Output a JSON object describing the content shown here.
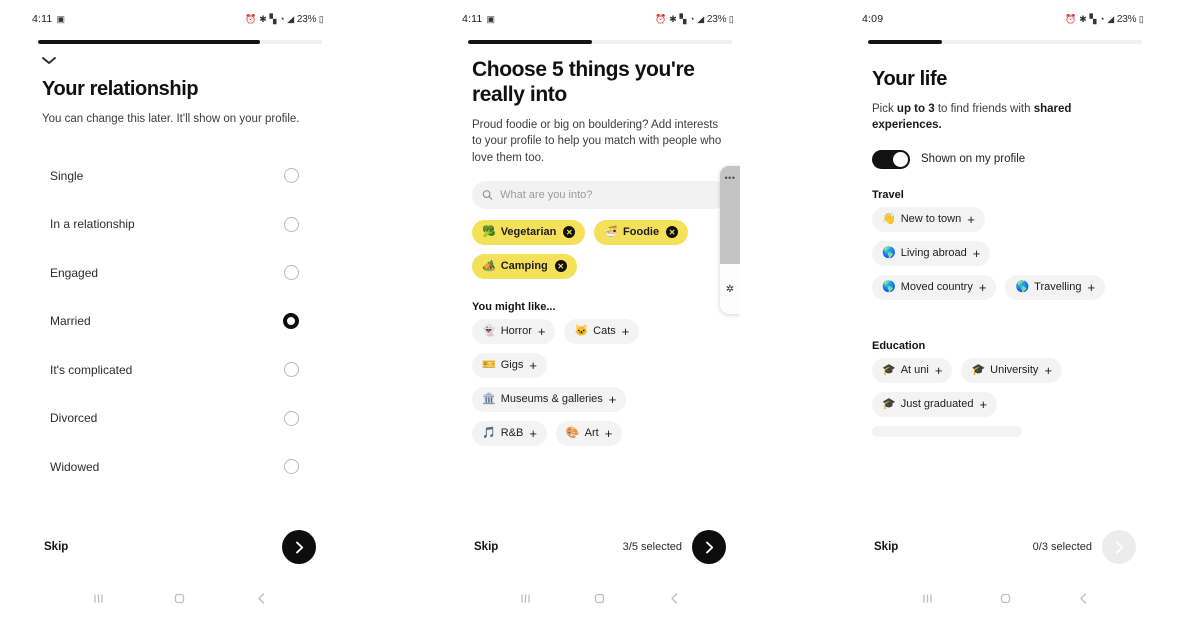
{
  "screens": [
    {
      "id": "relationship",
      "status": {
        "time": "4:11",
        "icons": [
          "alarm-icon",
          "bluetooth-icon",
          "wifi-icon",
          "mute-icon",
          "signal-icon"
        ],
        "battery": "23%"
      },
      "progress_percent": 78,
      "collapse_icon": "chevron-down-icon",
      "title": "Your relationship",
      "subtitle": "You can change this later. It'll show on your profile.",
      "options": [
        {
          "label": "Single",
          "selected": false
        },
        {
          "label": "In a relationship",
          "selected": false
        },
        {
          "label": "Engaged",
          "selected": false
        },
        {
          "label": "Married",
          "selected": true
        },
        {
          "label": "It's complicated",
          "selected": false
        },
        {
          "label": "Divorced",
          "selected": false
        },
        {
          "label": "Widowed",
          "selected": false
        }
      ],
      "skip_label": "Skip",
      "counter": "",
      "next_enabled": true,
      "nav": [
        "recents-icon",
        "home-icon",
        "back-icon"
      ]
    },
    {
      "id": "interests",
      "status": {
        "time": "4:11",
        "icons": [
          "alarm-icon",
          "bluetooth-icon",
          "wifi-icon",
          "mute-icon",
          "signal-icon"
        ],
        "battery": "23%"
      },
      "progress_percent": 47,
      "title": "Choose 5 things you're really into",
      "subtitle": "Proud foodie or big on bouldering? Add interests to your profile to help you match with people who love them too.",
      "search": {
        "placeholder": "What are you into?",
        "value": "",
        "icon": "search-icon"
      },
      "selected_chips": [
        {
          "emoji": "🥦",
          "label": "Vegetarian",
          "action": "remove"
        },
        {
          "emoji": "🍜",
          "label": "Foodie",
          "action": "remove"
        },
        {
          "emoji": "🏕️",
          "label": "Camping",
          "action": "remove"
        }
      ],
      "suggest_heading": "You might like...",
      "suggest_rows": [
        [
          {
            "emoji": "👻",
            "label": "Horror"
          },
          {
            "emoji": "🐱",
            "label": "Cats"
          }
        ],
        [
          {
            "emoji": "🎫",
            "label": "Gigs"
          }
        ],
        [
          {
            "emoji": "🏛️",
            "label": "Museums & galleries"
          }
        ],
        [
          {
            "emoji": "🎵",
            "label": "R&B"
          },
          {
            "emoji": "🎨",
            "label": "Art"
          }
        ]
      ],
      "skip_label": "Skip",
      "counter": "3/5 selected",
      "next_enabled": true,
      "edge_panel": {
        "menu_icon": "more-dots-icon",
        "bluetooth_icon": "bluetooth-icon"
      },
      "nav": [
        "recents-icon",
        "home-icon",
        "back-icon"
      ]
    },
    {
      "id": "your-life",
      "status": {
        "time": "4:09",
        "icons": [
          "alarm-icon",
          "bluetooth-icon",
          "wifi-icon",
          "mute-icon",
          "signal-icon"
        ],
        "battery": "23%"
      },
      "progress_percent": 27,
      "title": "Your life",
      "subtitle_parts": {
        "a": "Pick ",
        "b": "up to 3",
        "c": " to find friends with ",
        "d": "shared experiences."
      },
      "toggle": {
        "on": true,
        "label": "Shown on my profile"
      },
      "sections": [
        {
          "heading": "Travel",
          "rows": [
            [
              {
                "emoji": "👋",
                "label": "New to town"
              }
            ],
            [
              {
                "emoji": "🌎",
                "label": "Living abroad"
              }
            ],
            [
              {
                "emoji": "🌎",
                "label": "Moved country"
              },
              {
                "emoji": "🌎",
                "label": "Travelling"
              }
            ]
          ]
        },
        {
          "heading": "Education",
          "rows": [
            [
              {
                "emoji": "🎓",
                "label": "At uni"
              },
              {
                "emoji": "🎓",
                "label": "University"
              }
            ],
            [
              {
                "emoji": "🎓",
                "label": "Just graduated"
              }
            ]
          ]
        }
      ],
      "skip_label": "Skip",
      "counter": "0/3 selected",
      "next_enabled": false,
      "nav": [
        "recents-icon",
        "home-icon",
        "back-icon"
      ]
    }
  ],
  "colors": {
    "accent_yellow": "#f5e05a",
    "chip_grey": "#f3f3f3",
    "ink": "#0d0d0d",
    "disabled": "#ececec"
  }
}
